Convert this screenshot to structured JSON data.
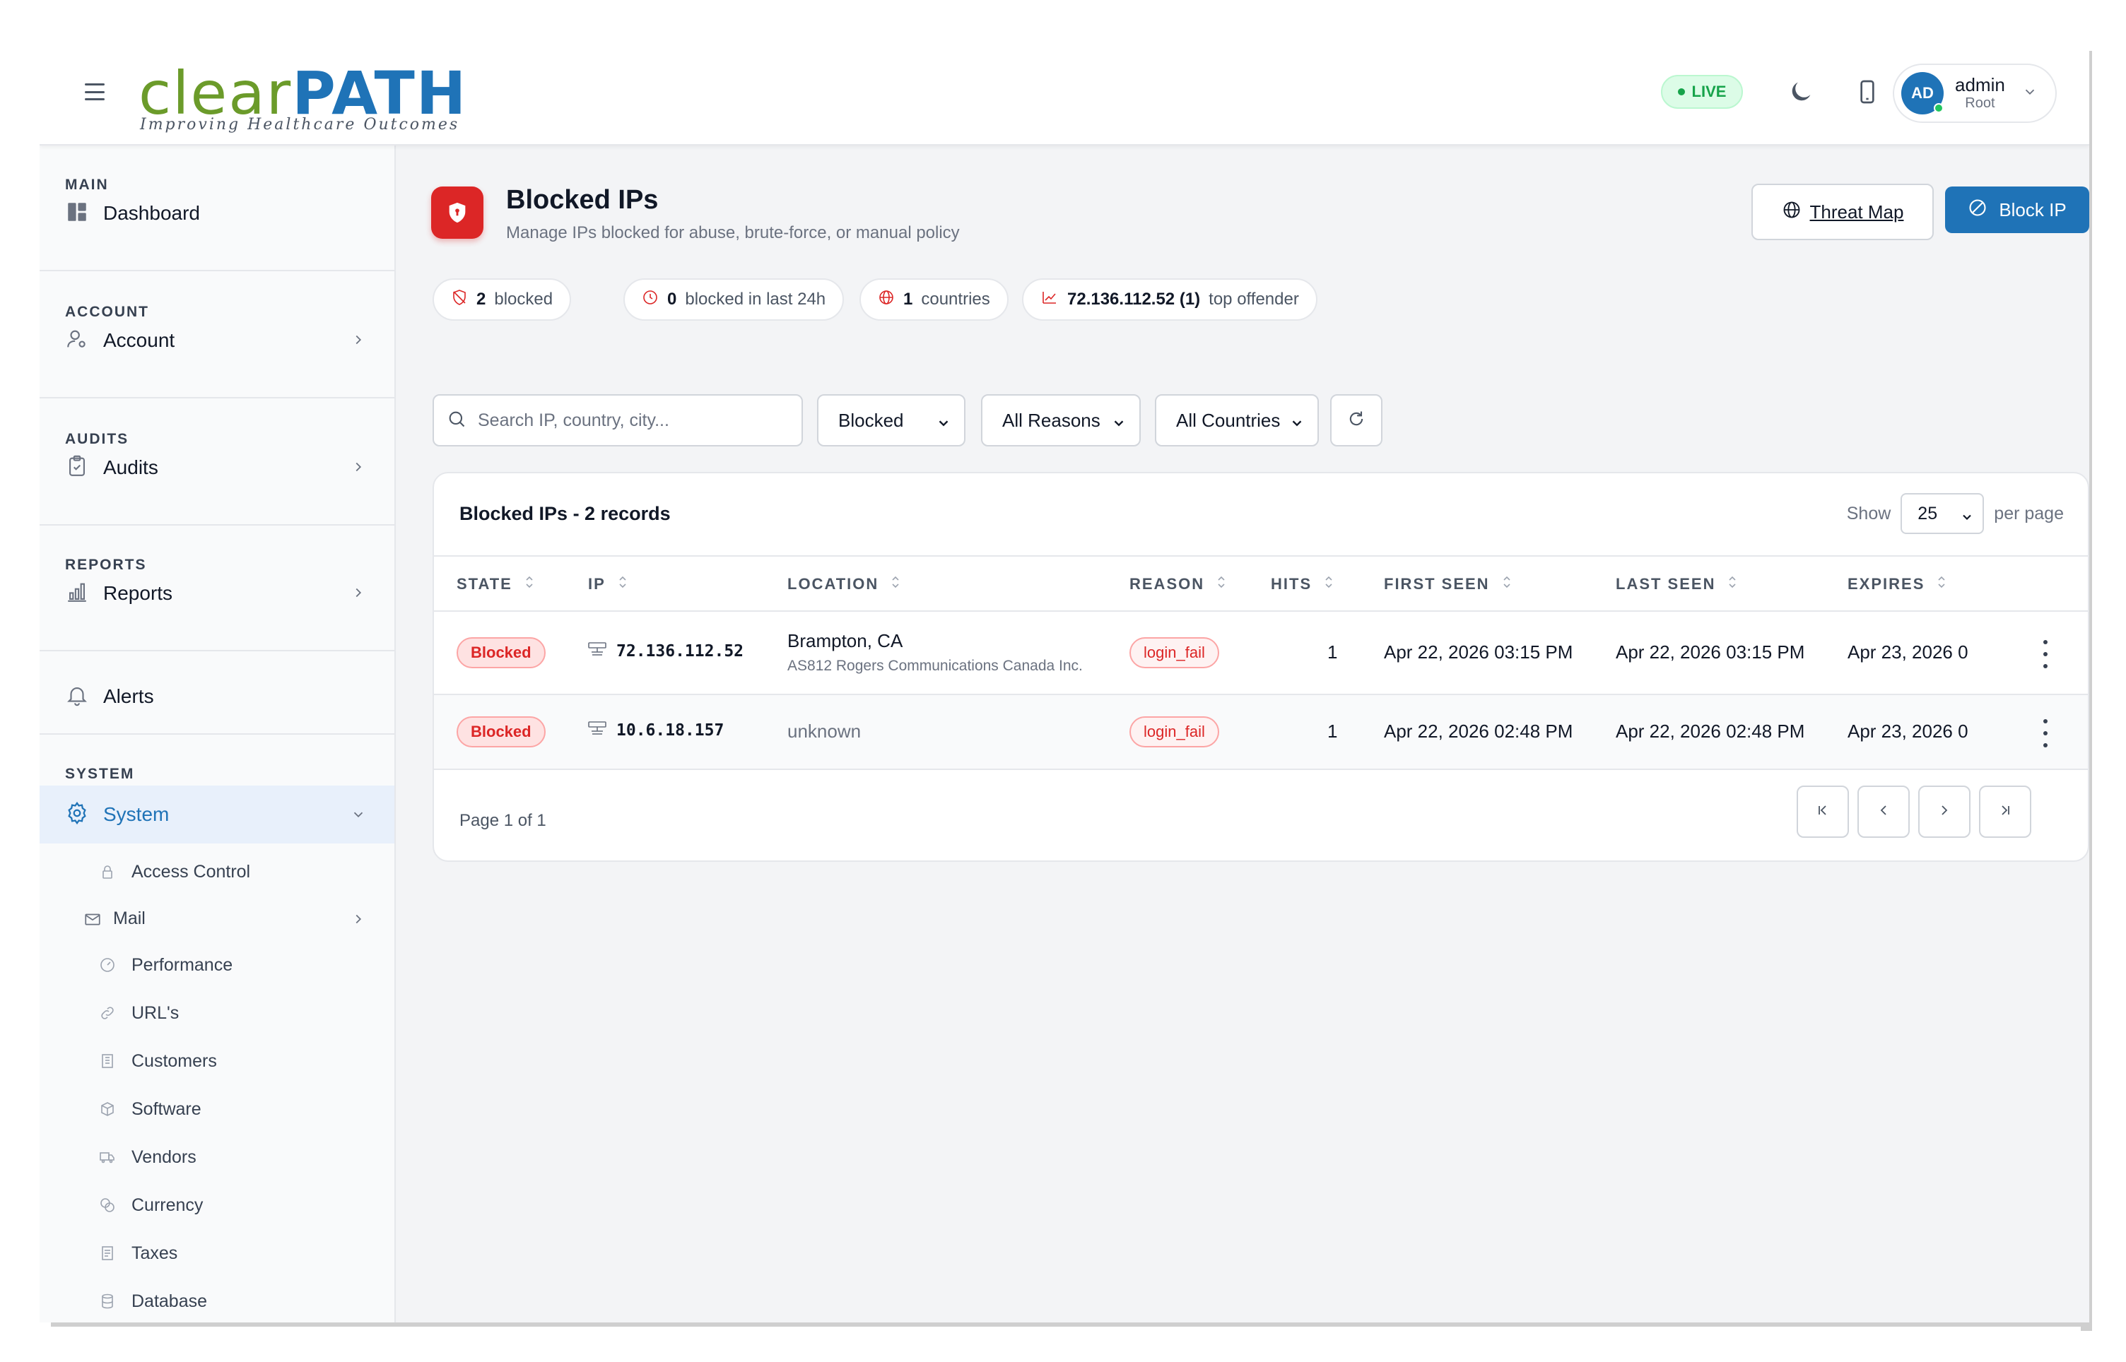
{
  "header": {
    "logo_clear": "clear",
    "logo_path": "PATH",
    "logo_tagline": "Improving Healthcare Outcomes",
    "live_label": "LIVE",
    "user_initials": "AD",
    "user_name": "admin",
    "user_role": "Root"
  },
  "sidebar": {
    "sections": {
      "main": "MAIN",
      "account": "ACCOUNT",
      "audits": "AUDITS",
      "reports": "REPORTS",
      "system": "SYSTEM"
    },
    "items": {
      "dashboard": "Dashboard",
      "account": "Account",
      "audits": "Audits",
      "reports": "Reports",
      "alerts": "Alerts",
      "system": "System"
    },
    "system_children": [
      {
        "label": "Access Control",
        "icon": "lock-icon"
      },
      {
        "label": "Mail",
        "icon": "mail-icon"
      },
      {
        "label": "Performance",
        "icon": "gauge-icon"
      },
      {
        "label": "URL's",
        "icon": "link-icon"
      },
      {
        "label": "Customers",
        "icon": "building-icon"
      },
      {
        "label": "Software",
        "icon": "box-icon"
      },
      {
        "label": "Vendors",
        "icon": "truck-icon"
      },
      {
        "label": "Currency",
        "icon": "coins-icon"
      },
      {
        "label": "Taxes",
        "icon": "receipt-icon"
      },
      {
        "label": "Database",
        "icon": "database-icon"
      }
    ]
  },
  "page": {
    "title": "Blocked IPs",
    "subtitle": "Manage IPs blocked for abuse, brute-force, or manual policy",
    "threat_map_label": "Threat Map",
    "block_ip_label": "Block IP"
  },
  "stats": {
    "blocked_count": "2",
    "blocked_label": "blocked",
    "last24_count": "0",
    "last24_label": "blocked in last 24h",
    "countries_count": "1",
    "countries_label": "countries",
    "top_offender": "72.136.112.52 (1)",
    "top_offender_label": "top offender"
  },
  "filters": {
    "search_placeholder": "Search IP, country, city...",
    "state": "Blocked",
    "reason": "All Reasons",
    "country": "All Countries"
  },
  "table": {
    "title": "Blocked IPs - 2 records",
    "show_label": "Show",
    "per_page_value": "25",
    "per_page_label": "per page",
    "columns": [
      "STATE",
      "IP",
      "LOCATION",
      "REASON",
      "HITS",
      "FIRST SEEN",
      "LAST SEEN",
      "EXPIRES"
    ],
    "rows": [
      {
        "state": "Blocked",
        "ip": "72.136.112.52",
        "location": "Brampton, CA",
        "location_sub": "AS812 Rogers Communications Canada Inc.",
        "reason": "login_fail",
        "hits": "1",
        "first_seen": "Apr 22, 2026 03:15 PM",
        "last_seen": "Apr 22, 2026 03:15 PM",
        "expires": "Apr 23, 2026 0"
      },
      {
        "state": "Blocked",
        "ip": "10.6.18.157",
        "location": "unknown",
        "location_sub": "",
        "reason": "login_fail",
        "hits": "1",
        "first_seen": "Apr 22, 2026 02:48 PM",
        "last_seen": "Apr 22, 2026 02:48 PM",
        "expires": "Apr 23, 2026 0"
      }
    ],
    "pagination": "Page 1 of 1"
  },
  "colors": {
    "brand_blue": "#1f73b7",
    "brand_green": "#6b9b2a",
    "danger": "#dc2626",
    "live_green": "#16a34a"
  }
}
